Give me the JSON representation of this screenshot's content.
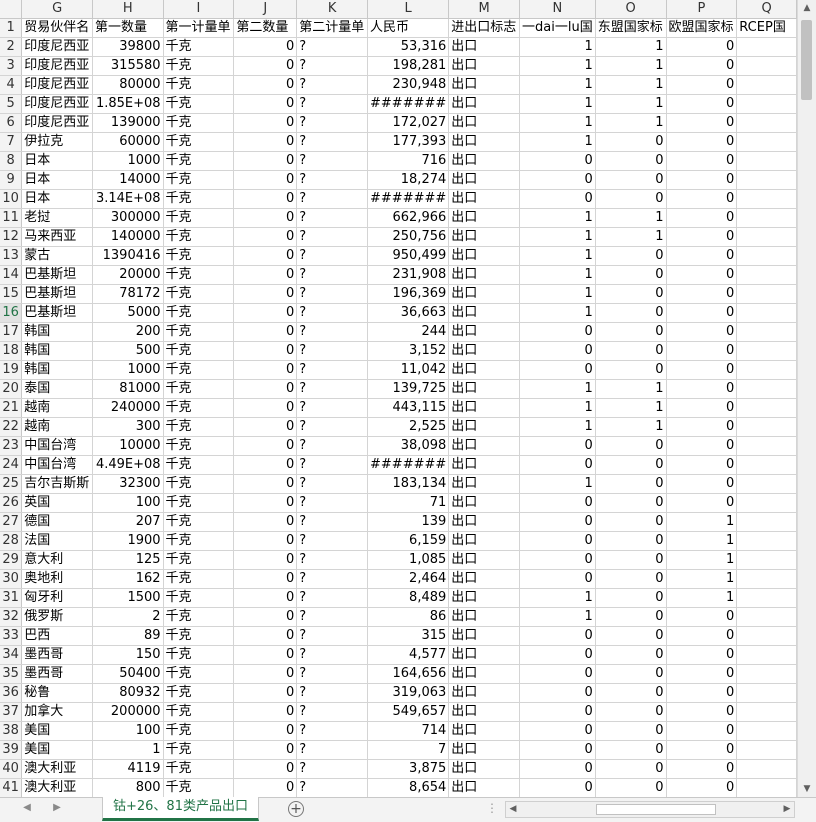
{
  "columns": [
    "G",
    "H",
    "I",
    "J",
    "K",
    "L",
    "M",
    "N",
    "O",
    "P",
    "Q"
  ],
  "header_row": {
    "row": "1",
    "cells": [
      "贸易伙伴名",
      "第一数量",
      "第一计量单",
      "第二数量",
      "第二计量单",
      "人民币",
      "进出口标志",
      "一dai一lu国",
      "东盟国家标",
      "欧盟国家标",
      "RCEP国"
    ]
  },
  "rows": [
    {
      "row": "2",
      "cells": [
        "印度尼西亚",
        "39800",
        "千克",
        "0",
        "?",
        "53,316",
        "出口",
        "1",
        "1",
        "0",
        ""
      ]
    },
    {
      "row": "3",
      "cells": [
        "印度尼西亚",
        "315580",
        "千克",
        "0",
        "?",
        "198,281",
        "出口",
        "1",
        "1",
        "0",
        ""
      ]
    },
    {
      "row": "4",
      "cells": [
        "印度尼西亚",
        "80000",
        "千克",
        "0",
        "?",
        "230,948",
        "出口",
        "1",
        "1",
        "0",
        ""
      ]
    },
    {
      "row": "5",
      "cells": [
        "印度尼西亚",
        "1.85E+08",
        "千克",
        "0",
        "?",
        "#######",
        "出口",
        "1",
        "1",
        "0",
        ""
      ]
    },
    {
      "row": "6",
      "cells": [
        "印度尼西亚",
        "139000",
        "千克",
        "0",
        "?",
        "172,027",
        "出口",
        "1",
        "1",
        "0",
        ""
      ]
    },
    {
      "row": "7",
      "cells": [
        "伊拉克",
        "60000",
        "千克",
        "0",
        "?",
        "177,393",
        "出口",
        "1",
        "0",
        "0",
        ""
      ]
    },
    {
      "row": "8",
      "cells": [
        "日本",
        "1000",
        "千克",
        "0",
        "?",
        "716",
        "出口",
        "0",
        "0",
        "0",
        ""
      ]
    },
    {
      "row": "9",
      "cells": [
        "日本",
        "14000",
        "千克",
        "0",
        "?",
        "18,274",
        "出口",
        "0",
        "0",
        "0",
        ""
      ]
    },
    {
      "row": "10",
      "cells": [
        "日本",
        "3.14E+08",
        "千克",
        "0",
        "?",
        "#######",
        "出口",
        "0",
        "0",
        "0",
        ""
      ]
    },
    {
      "row": "11",
      "cells": [
        "老挝",
        "300000",
        "千克",
        "0",
        "?",
        "662,966",
        "出口",
        "1",
        "1",
        "0",
        ""
      ]
    },
    {
      "row": "12",
      "cells": [
        "马来西亚",
        "140000",
        "千克",
        "0",
        "?",
        "250,756",
        "出口",
        "1",
        "1",
        "0",
        ""
      ]
    },
    {
      "row": "13",
      "cells": [
        "蒙古",
        "1390416",
        "千克",
        "0",
        "?",
        "950,499",
        "出口",
        "1",
        "0",
        "0",
        ""
      ]
    },
    {
      "row": "14",
      "cells": [
        "巴基斯坦",
        "20000",
        "千克",
        "0",
        "?",
        "231,908",
        "出口",
        "1",
        "0",
        "0",
        ""
      ]
    },
    {
      "row": "15",
      "cells": [
        "巴基斯坦",
        "78172",
        "千克",
        "0",
        "?",
        "196,369",
        "出口",
        "1",
        "0",
        "0",
        ""
      ]
    },
    {
      "row": "16",
      "cells": [
        "巴基斯坦",
        "5000",
        "千克",
        "0",
        "?",
        "36,663",
        "出口",
        "1",
        "0",
        "0",
        ""
      ]
    },
    {
      "row": "17",
      "cells": [
        "韩国",
        "200",
        "千克",
        "0",
        "?",
        "244",
        "出口",
        "0",
        "0",
        "0",
        ""
      ]
    },
    {
      "row": "18",
      "cells": [
        "韩国",
        "500",
        "千克",
        "0",
        "?",
        "3,152",
        "出口",
        "0",
        "0",
        "0",
        ""
      ]
    },
    {
      "row": "19",
      "cells": [
        "韩国",
        "1000",
        "千克",
        "0",
        "?",
        "11,042",
        "出口",
        "0",
        "0",
        "0",
        ""
      ]
    },
    {
      "row": "20",
      "cells": [
        "泰国",
        "81000",
        "千克",
        "0",
        "?",
        "139,725",
        "出口",
        "1",
        "1",
        "0",
        ""
      ]
    },
    {
      "row": "21",
      "cells": [
        "越南",
        "240000",
        "千克",
        "0",
        "?",
        "443,115",
        "出口",
        "1",
        "1",
        "0",
        ""
      ]
    },
    {
      "row": "22",
      "cells": [
        "越南",
        "300",
        "千克",
        "0",
        "?",
        "2,525",
        "出口",
        "1",
        "1",
        "0",
        ""
      ]
    },
    {
      "row": "23",
      "cells": [
        "中国台湾",
        "10000",
        "千克",
        "0",
        "?",
        "38,098",
        "出口",
        "0",
        "0",
        "0",
        ""
      ]
    },
    {
      "row": "24",
      "cells": [
        "中国台湾",
        "4.49E+08",
        "千克",
        "0",
        "?",
        "#######",
        "出口",
        "0",
        "0",
        "0",
        ""
      ]
    },
    {
      "row": "25",
      "cells": [
        "吉尔吉斯斯",
        "32300",
        "千克",
        "0",
        "?",
        "183,134",
        "出口",
        "1",
        "0",
        "0",
        ""
      ]
    },
    {
      "row": "26",
      "cells": [
        "英国",
        "100",
        "千克",
        "0",
        "?",
        "71",
        "出口",
        "0",
        "0",
        "0",
        ""
      ]
    },
    {
      "row": "27",
      "cells": [
        "德国",
        "207",
        "千克",
        "0",
        "?",
        "139",
        "出口",
        "0",
        "0",
        "1",
        ""
      ]
    },
    {
      "row": "28",
      "cells": [
        "法国",
        "1900",
        "千克",
        "0",
        "?",
        "6,159",
        "出口",
        "0",
        "0",
        "1",
        ""
      ]
    },
    {
      "row": "29",
      "cells": [
        "意大利",
        "125",
        "千克",
        "0",
        "?",
        "1,085",
        "出口",
        "0",
        "0",
        "1",
        ""
      ]
    },
    {
      "row": "30",
      "cells": [
        "奥地利",
        "162",
        "千克",
        "0",
        "?",
        "2,464",
        "出口",
        "0",
        "0",
        "1",
        ""
      ]
    },
    {
      "row": "31",
      "cells": [
        "匈牙利",
        "1500",
        "千克",
        "0",
        "?",
        "8,489",
        "出口",
        "1",
        "0",
        "1",
        ""
      ]
    },
    {
      "row": "32",
      "cells": [
        "俄罗斯",
        "2",
        "千克",
        "0",
        "?",
        "86",
        "出口",
        "1",
        "0",
        "0",
        ""
      ]
    },
    {
      "row": "33",
      "cells": [
        "巴西",
        "89",
        "千克",
        "0",
        "?",
        "315",
        "出口",
        "0",
        "0",
        "0",
        ""
      ]
    },
    {
      "row": "34",
      "cells": [
        "墨西哥",
        "150",
        "千克",
        "0",
        "?",
        "4,577",
        "出口",
        "0",
        "0",
        "0",
        ""
      ]
    },
    {
      "row": "35",
      "cells": [
        "墨西哥",
        "50400",
        "千克",
        "0",
        "?",
        "164,656",
        "出口",
        "0",
        "0",
        "0",
        ""
      ]
    },
    {
      "row": "36",
      "cells": [
        "秘鲁",
        "80932",
        "千克",
        "0",
        "?",
        "319,063",
        "出口",
        "0",
        "0",
        "0",
        ""
      ]
    },
    {
      "row": "37",
      "cells": [
        "加拿大",
        "200000",
        "千克",
        "0",
        "?",
        "549,657",
        "出口",
        "0",
        "0",
        "0",
        ""
      ]
    },
    {
      "row": "38",
      "cells": [
        "美国",
        "100",
        "千克",
        "0",
        "?",
        "714",
        "出口",
        "0",
        "0",
        "0",
        ""
      ]
    },
    {
      "row": "39",
      "cells": [
        "美国",
        "1",
        "千克",
        "0",
        "?",
        "7",
        "出口",
        "0",
        "0",
        "0",
        ""
      ]
    },
    {
      "row": "40",
      "cells": [
        "澳大利亚",
        "4119",
        "千克",
        "0",
        "?",
        "3,875",
        "出口",
        "0",
        "0",
        "0",
        ""
      ]
    },
    {
      "row": "41",
      "cells": [
        "澳大利亚",
        "800",
        "千克",
        "0",
        "?",
        "8,654",
        "出口",
        "0",
        "0",
        "0",
        ""
      ]
    }
  ],
  "selected_row": "16",
  "sheet_tab": {
    "label": "钴+26、81类产品出口"
  },
  "add_sheet_label": "+",
  "nav_prev": "◀",
  "nav_next": "▶",
  "dots": "⋮",
  "vscroll": {
    "up": "▲",
    "down": "▼"
  },
  "hscroll": {
    "left": "◀",
    "right": "▶"
  },
  "colors": {
    "accent": "#217346",
    "header_bg": "#f3f3f3",
    "gridline": "#d4d4d4"
  }
}
